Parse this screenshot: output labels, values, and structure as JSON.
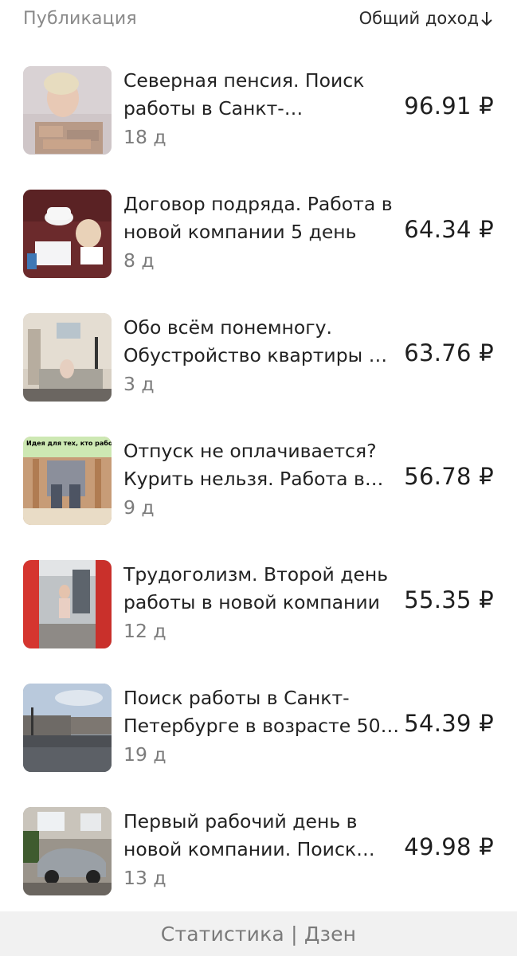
{
  "header": {
    "publication_label": "Публикация",
    "sort_label": "Общий доход",
    "sort_icon": "arrow-down-icon"
  },
  "items": [
    {
      "title": "Северная пенсия. Поиск работы в Санкт-…",
      "age": "18 д",
      "amount": "96.91 ₽"
    },
    {
      "title": "Договор подряда. Работа в новой компании 5 день",
      "age": "8 д",
      "amount": "64.34 ₽"
    },
    {
      "title": "Обо всём понемногу. Обустройство квартиры …",
      "age": "3 д",
      "amount": "63.76 ₽"
    },
    {
      "title": "Отпуск не оплачивается? Курить нельзя. Работа в…",
      "age": "9 д",
      "amount": "56.78 ₽",
      "thumb_caption": "Идея для тех, кто работает без отпуска"
    },
    {
      "title": "Трудоголизм. Второй день работы в новой компании",
      "age": "12 д",
      "amount": "55.35 ₽"
    },
    {
      "title": "Поиск работы в Санкт-Петербурге в возрасте 50…",
      "age": "19 д",
      "amount": "54.39 ₽"
    },
    {
      "title": "Первый рабочий день в новой компании. Поиск…",
      "age": "13 д",
      "amount": "49.98 ₽"
    }
  ],
  "footer": {
    "text": "Статистика | Дзен"
  }
}
